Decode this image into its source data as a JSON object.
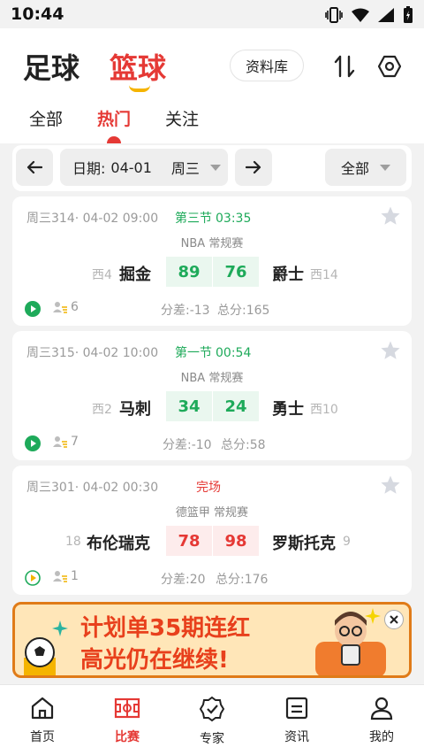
{
  "status_bar": {
    "time": "10:44"
  },
  "header": {
    "sport_tabs": [
      "足球",
      "篮球"
    ],
    "database_button": "资料库",
    "sub_tabs": [
      "全部",
      "热门",
      "关注"
    ]
  },
  "filter": {
    "date_label": "日期:",
    "date_value": "04-01",
    "weekday": "周三",
    "scope": "全部"
  },
  "matches": [
    {
      "meta": "周三314· 04-02 09:00",
      "status": "第三节",
      "clock": "03:35",
      "league": "NBA 常规赛",
      "home_rank": "西4",
      "home": "掘金",
      "home_score": "89",
      "away_score": "76",
      "away": "爵士",
      "away_rank": "西14",
      "fans": "6",
      "diff": "分差:-13",
      "total": "总分:165"
    },
    {
      "meta": "周三315· 04-02 10:00",
      "status": "第一节",
      "clock": "00:54",
      "league": "NBA 常规赛",
      "home_rank": "西2",
      "home": "马刺",
      "home_score": "34",
      "away_score": "24",
      "away": "勇士",
      "away_rank": "西10",
      "fans": "7",
      "diff": "分差:-10",
      "total": "总分:58"
    },
    {
      "meta": "周三301· 04-02 00:30",
      "status": "完场",
      "clock": "",
      "league": "德篮甲 常规赛",
      "home_rank": "18",
      "home": "布伦瑞克",
      "home_score": "78",
      "away_score": "98",
      "away": "罗斯托克",
      "away_rank": "9",
      "fans": "1",
      "diff": "分差:20",
      "total": "总分:176"
    }
  ],
  "banner": {
    "line1": "计划单35期连红",
    "line2": "高光仍在继续!"
  },
  "bottom_nav": [
    "首页",
    "比赛",
    "专家",
    "资讯",
    "我的"
  ],
  "colors": {
    "accent": "#e53935",
    "live": "#1eaa5a",
    "banner_bg": "#ffe6b8"
  }
}
